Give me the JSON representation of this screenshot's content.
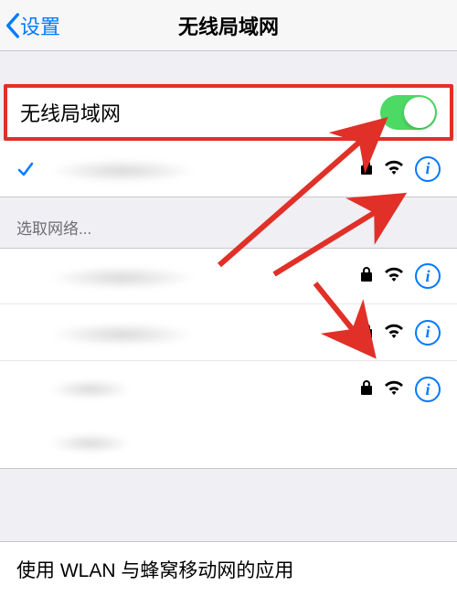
{
  "header": {
    "back_label": "设置",
    "title": "无线局域网"
  },
  "wifi_toggle": {
    "label": "无线局域网",
    "enabled": true
  },
  "connected": {
    "name_redacted": true,
    "secured": true
  },
  "choose_network_label": "选取网络...",
  "networks": [
    {
      "name_redacted": true,
      "secured": true
    },
    {
      "name_redacted": true,
      "secured": true
    },
    {
      "name_redacted": true,
      "secured": true
    }
  ],
  "footer_label": "使用 WLAN 与蜂窝移动网的应用",
  "annotation": {
    "arrows": true,
    "arrow_color": "#e03028"
  }
}
